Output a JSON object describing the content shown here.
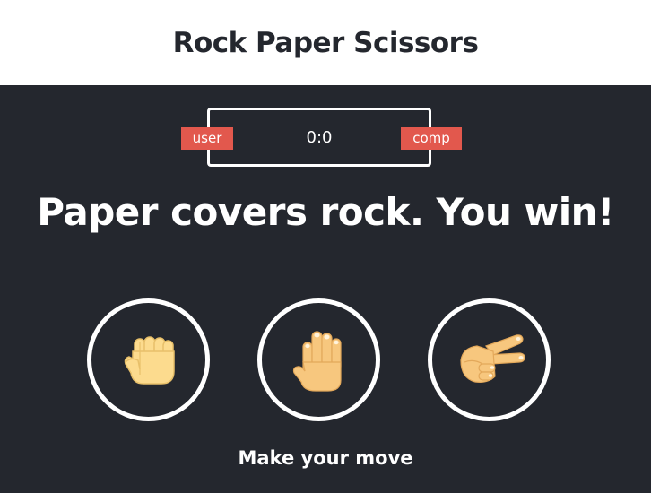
{
  "header": {
    "title": "Rock Paper Scissors"
  },
  "scoreboard": {
    "user_label": "user",
    "comp_label": "comp",
    "score": "0:0"
  },
  "result": {
    "message": "Paper covers rock. You win!"
  },
  "choices": [
    {
      "name": "rock",
      "icon": "fist-icon"
    },
    {
      "name": "paper",
      "icon": "raised-hand-icon"
    },
    {
      "name": "scissors",
      "icon": "victory-hand-icon"
    }
  ],
  "prompt": {
    "text": "Make your move"
  },
  "colors": {
    "background": "#24272e",
    "header_bg": "#ffffff",
    "badge": "#e2584d",
    "text": "#ffffff"
  }
}
